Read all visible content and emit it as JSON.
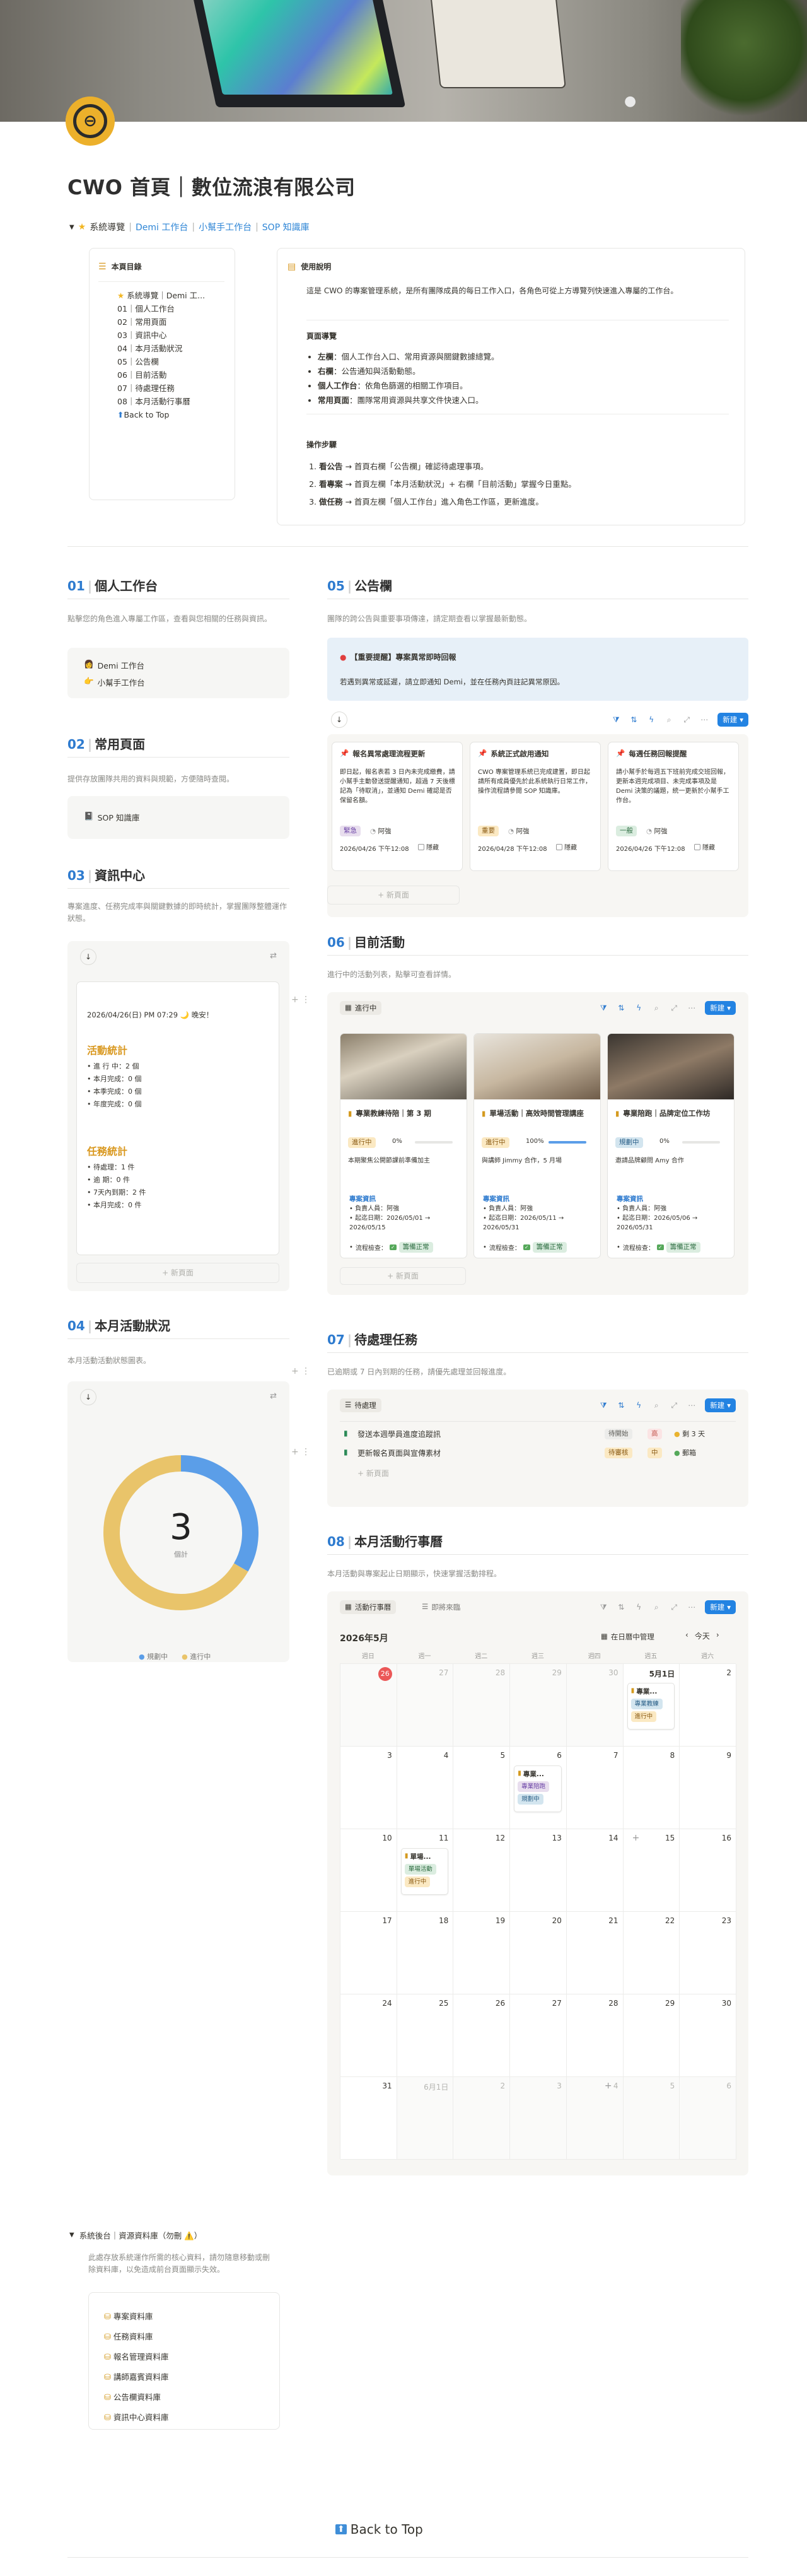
{
  "page": {
    "title": "CWO 首頁｜數位流浪有限公司",
    "nav_toggle_label": "系統導覽",
    "nav_links": [
      "Demi 工作台",
      "小幫手工作台",
      "SOP 知識庫"
    ],
    "back_to_top": "Back to Top"
  },
  "toc": {
    "title": "本頁目錄",
    "items": [
      "系統導覽｜Demi 工...",
      "01｜個人工作台",
      "02｜常用頁面",
      "03｜資訊中心",
      "04｜本月活動狀況",
      "05｜公告欄",
      "06｜目前活動",
      "07｜待處理任務",
      "08｜本月活動行事曆"
    ],
    "back": "Back to Top"
  },
  "usage": {
    "title": "使用說明",
    "intro": "這是 CWO 的專案管理系統，是所有團隊成員的每日工作入口，各角色可從上方導覽列快速進入專屬的工作台。",
    "nav_title": "頁面導覽",
    "nav_items": [
      {
        "k": "左欄",
        "v": "：個人工作台入口、常用資源與關鍵數據總覽。"
      },
      {
        "k": "右欄",
        "v": "：公告通知與活動動態。"
      },
      {
        "k": "個人工作台",
        "v": "：依角色篩選的相關工作項目。"
      },
      {
        "k": "常用頁面",
        "v": "：團隊常用資源與共享文件快速入口。"
      }
    ],
    "steps_title": "操作步驟",
    "steps": [
      {
        "k": "看公告",
        "v": " → 首頁右欄「公告欄」確認待處理事項。"
      },
      {
        "k": "看專案",
        "v": " → 首頁左欄「本月活動狀況」+ 右欄「目前活動」掌握今日重點。"
      },
      {
        "k": "做任務",
        "v": " → 首頁左欄「個人工作台」進入角色工作區，更新進度。"
      }
    ]
  },
  "s01": {
    "num": "01",
    "title": "個人工作台",
    "desc": "點擊您的角色進入專屬工作區，查看與您相關的任務與資訊。",
    "links": [
      "Demi 工作台",
      "小幫手工作台"
    ]
  },
  "s02": {
    "num": "02",
    "title": "常用頁面",
    "desc": "提供存放團隊共用的資料與規範，方便隨時查閱。",
    "link": "SOP 知識庫"
  },
  "s03": {
    "num": "03",
    "title": "資訊中心",
    "desc": "專案進度、任務完成率與關鍵數據的即時統計，掌握團隊整體運作狀態。",
    "timestamp": "2026/04/26(日) PM 07:29 🌙 晚安！",
    "activity_title": "活動統計",
    "activity": [
      "進 行 中：2 個",
      "本月完成：0 個",
      "本季完成：0 個",
      "年度完成：0 個"
    ],
    "task_title": "任務統計",
    "task": [
      "待處理：1 件",
      "逾 期：0 件",
      "7天內到期：2 件",
      "本月完成：0 件"
    ],
    "new_page": "+ 新頁面"
  },
  "s04": {
    "num": "04",
    "title": "本月活動狀況",
    "desc": "本月活動活動狀態圖表。",
    "total": "3",
    "total_label": "個計",
    "legend": [
      "規劃中",
      "進行中"
    ],
    "colors": {
      "planning": "#5b9ee8",
      "ongoing": "#e9c46a"
    }
  },
  "chart_data": {
    "type": "pie",
    "categories": [
      "規劃中",
      "進行中"
    ],
    "values": [
      1,
      2
    ],
    "title": "3",
    "xlabel": "",
    "ylabel": ""
  },
  "s05": {
    "num": "05",
    "title": "公告欄",
    "desc": "團隊的跨公告與重要事項傳達，請定期查看以掌握最新動態。",
    "alert_title": "【重要提醒】專案異常即時回報",
    "alert_body": "若遇到異常或延遲，請立即通知 Demi，並在任務內頁註記異常原因。",
    "new": "新建",
    "cards": [
      {
        "title": "報名異常處理流程更新",
        "body": "即日起，報名表若 3 日內未完成繳費，請小幫手主動發送提醒通知，超過 7 天後標記為「待取消」，並通知 Demi 確認是否保留名額。",
        "tag": "緊急",
        "owner": "阿強",
        "date": "2026/04/26 下午12:08",
        "pin": "隱藏"
      },
      {
        "title": "系統正式啟用通知",
        "body": "CWO 專案管理系統已完成建置，即日起請所有成員優先於此系統執行日常工作，操作流程請參閱 SOP 知識庫。",
        "tag": "重要",
        "owner": "阿強",
        "date": "2026/04/28 下午12:08",
        "pin": "隱藏"
      },
      {
        "title": "每週任務回報提醒",
        "body": "請小幫手於每週五下班前完成交班回報，更新本週完成項目、未完成事項及是 Demi 決策的議題，統一更新於小幫手工作台。",
        "tag": "一般",
        "owner": "阿強",
        "date": "2026/04/26 下午12:08",
        "pin": "隱藏"
      }
    ],
    "new_page": "+ 新頁面"
  },
  "s06": {
    "num": "06",
    "title": "目前活動",
    "desc": "進行中的活動列表，點擊可查看詳情。",
    "group": "進行中",
    "new": "新建",
    "cards": [
      {
        "title": "專業教練待陪｜第 3 期",
        "sub": "本期聚焦公開節課前準備加主",
        "info": "專案資訊",
        "owner": "負責人員：阿強",
        "range": "起迄日期：2026/05/01 → 2026/05/15",
        "progress_label": "流程檢查：",
        "status": "籌備正常"
      },
      {
        "title": "單場活動｜高效時間管理講座",
        "sub": "與講師 Jimmy 合作，5 月場",
        "info": "專案資訊",
        "owner": "負責人員：阿強",
        "range": "起迄日期：2026/05/11 → 2026/05/31",
        "progress_label": "流程檢查：",
        "status": "籌備正常"
      },
      {
        "title": "專業陪跑｜品牌定位工作坊",
        "sub": "邀請品牌顧問 Amy 合作",
        "info": "專案資訊",
        "owner": "負責人員：阿強",
        "range": "起迄日期：2026/05/06 → 2026/05/31",
        "progress_label": "流程檢查：",
        "status": "籌備正常"
      }
    ],
    "tags": [
      "進行中",
      "進行中",
      "規劃中"
    ],
    "pcts": [
      "0%",
      "100%",
      "0%"
    ],
    "progress": [
      0,
      1,
      0
    ],
    "new_page": "+ 新頁面"
  },
  "s07": {
    "num": "07",
    "title": "待處理任務",
    "desc": "已逾期或 7 日內到期的任務，請優先處理並回報進度。",
    "view": "待處理",
    "new": "新建",
    "rows": [
      {
        "title": "發送本週學員進度追蹤訊",
        "s1": "待開始",
        "s2": "高",
        "due": "剩 3 天"
      },
      {
        "title": "更新報名頁面與宣傳素材",
        "s1": "待審核",
        "s2": "中",
        "due": "郵箱"
      }
    ],
    "new_page": "+ 新頁面"
  },
  "s08": {
    "num": "08",
    "title": "本月活動行事曆",
    "desc": "本月活動與專案起止日期顯示，快速掌握活動排程。",
    "views": [
      "活動行事曆",
      "即將來臨"
    ],
    "new": "新建",
    "month": "2026年5月",
    "open_in": "在日曆中管理",
    "today": "今天",
    "weekdays": [
      "週日",
      "週一",
      "週二",
      "週三",
      "週四",
      "週五",
      "週六"
    ],
    "weeks": [
      [
        "26",
        "27",
        "28",
        "29",
        "30",
        "5月1日",
        "2"
      ],
      [
        "3",
        "4",
        "5",
        "6",
        "7",
        "8",
        "9"
      ],
      [
        "10",
        "11",
        "12",
        "13",
        "14",
        "15",
        "16"
      ],
      [
        "17",
        "18",
        "19",
        "20",
        "21",
        "22",
        "23"
      ],
      [
        "24",
        "25",
        "26",
        "27",
        "28",
        "29",
        "30"
      ],
      [
        "31",
        "6月1日",
        "2",
        "3",
        "4",
        "5",
        "6"
      ]
    ],
    "events": [
      {
        "title": "專業...",
        "t1": "專業教練",
        "t2": "進行中"
      },
      {
        "title": "專業...",
        "t1": "專業陪跑",
        "t2": "規劃中"
      },
      {
        "title": "單場...",
        "t1": "單場活動",
        "t2": "進行中"
      }
    ]
  },
  "backend": {
    "toggle": "系統後台｜資源資料庫（勿刪 ⚠️）",
    "desc": "此處存放系統運作所需的核心資料，請勿隨意移動或刪除資料庫，以免造成前台頁面顯示失效。",
    "dbs": [
      "專案資料庫",
      "任務資料庫",
      "報名管理資料庫",
      "講師嘉賓資料庫",
      "公告欄資料庫",
      "資訊中心資料庫"
    ]
  }
}
